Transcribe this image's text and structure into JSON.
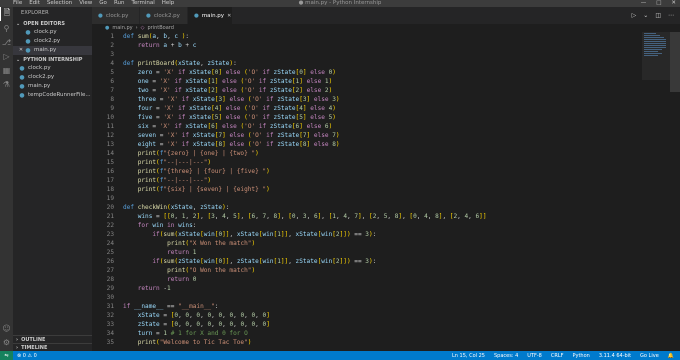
{
  "titlebar": {
    "menu": [
      "File",
      "Edit",
      "Selection",
      "View",
      "Go",
      "Run",
      "Terminal",
      "Help"
    ],
    "title": "● main.py - Python Internship"
  },
  "sidebar": {
    "title": "EXPLORER",
    "open_editors_label": "OPEN EDITORS",
    "open_editors": [
      "clock.py",
      "clock2.py",
      "main.py"
    ],
    "project_label": "PYTHON INTERNSHIP",
    "project_files": [
      "clock.py",
      "clock2.py",
      "main.py",
      "tempCodeRunnerFile..."
    ],
    "outline_label": "OUTLINE",
    "timeline_label": "TIMELINE"
  },
  "tabs": [
    "clock.py",
    "clock2.py",
    "main.py"
  ],
  "breadcrumb": {
    "file": "main.py",
    "symbol": "printBoard"
  },
  "statusbar": {
    "errors": "⊗ 0 ⚠ 0",
    "position": "Ln 15, Col 25",
    "spaces": "Spaces: 4",
    "encoding": "UTF-8",
    "eol": "CRLF",
    "language": "Python",
    "interpreter": "3.11.4 64-bit",
    "golive": "Go Live"
  },
  "icons": {
    "explorer": "files-icon",
    "search": "search-icon",
    "scm": "source-control-icon",
    "run": "run-debug-icon",
    "extensions": "extensions-icon",
    "testing": "flask-icon",
    "accounts": "account-icon",
    "settings": "gear-icon"
  },
  "code_lines": [
    {
      "n": "1",
      "t": "def sum(a, b, c ):"
    },
    {
      "n": "2",
      "t": "    return a + b + c"
    },
    {
      "n": "3",
      "t": ""
    },
    {
      "n": "4",
      "t": "def printBoard(xState, zState):"
    },
    {
      "n": "5",
      "t": "    zero = 'X' if xState[0] else ('O' if zState[0] else 0)"
    },
    {
      "n": "6",
      "t": "    one = 'X' if xState[1] else ('O' if zState[1] else 1)"
    },
    {
      "n": "7",
      "t": "    two = 'X' if xState[2] else ('O' if zState[2] else 2)"
    },
    {
      "n": "8",
      "t": "    three = 'X' if xState[3] else ('O' if zState[3] else 3)"
    },
    {
      "n": "9",
      "t": "    four = 'X' if xState[4] else ('O' if zState[4] else 4)"
    },
    {
      "n": "10",
      "t": "    five = 'X' if xState[5] else ('O' if zState[5] else 5)"
    },
    {
      "n": "11",
      "t": "    six = 'X' if xState[6] else ('O' if zState[6] else 6)"
    },
    {
      "n": "12",
      "t": "    seven = 'X' if xState[7] else ('O' if zState[7] else 7)"
    },
    {
      "n": "13",
      "t": "    eight = 'X' if xState[8] else ('O' if zState[8] else 8)"
    },
    {
      "n": "14",
      "t": "    print(f\"{zero} | {one} | {two} \")"
    },
    {
      "n": "15",
      "t": "    print(f\"--|---|---\")"
    },
    {
      "n": "16",
      "t": "    print(f\"{three} | {four} | {five} \")"
    },
    {
      "n": "17",
      "t": "    print(f\"--|---|---\")"
    },
    {
      "n": "18",
      "t": "    print(f\"{six} | {seven} | {eight} \")"
    },
    {
      "n": "19",
      "t": ""
    },
    {
      "n": "20",
      "t": "def checkWin(xState, zState):"
    },
    {
      "n": "21",
      "t": "    wins = [[0, 1, 2], [3, 4, 5], [6, 7, 8], [0, 3, 6], [1, 4, 7], [2, 5, 8], [0, 4, 8], [2, 4, 6]]"
    },
    {
      "n": "22",
      "t": "    for win in wins:"
    },
    {
      "n": "23",
      "t": "        if(sum(xState[win[0]], xState[win[1]], xState[win[2]]) == 3):"
    },
    {
      "n": "24",
      "t": "            print(\"X Won the match\")"
    },
    {
      "n": "25",
      "t": "            return 1"
    },
    {
      "n": "26",
      "t": "        if(sum(zState[win[0]], zState[win[1]], zState[win[2]]) == 3):"
    },
    {
      "n": "27",
      "t": "            print(\"O Won the match\")"
    },
    {
      "n": "28",
      "t": "            return 0"
    },
    {
      "n": "29",
      "t": "    return -1"
    },
    {
      "n": "30",
      "t": ""
    },
    {
      "n": "31",
      "t": "if __name__ == \"__main__\":"
    },
    {
      "n": "32",
      "t": "    xState = [0, 0, 0, 0, 0, 0, 0, 0, 0]"
    },
    {
      "n": "33",
      "t": "    zState = [0, 0, 0, 0, 0, 0, 0, 0, 0]"
    },
    {
      "n": "34",
      "t": "    turn = 1 # 1 for X and 0 for O"
    },
    {
      "n": "35",
      "t": "    print(\"Welcome to Tic Tac Toe\")"
    }
  ]
}
